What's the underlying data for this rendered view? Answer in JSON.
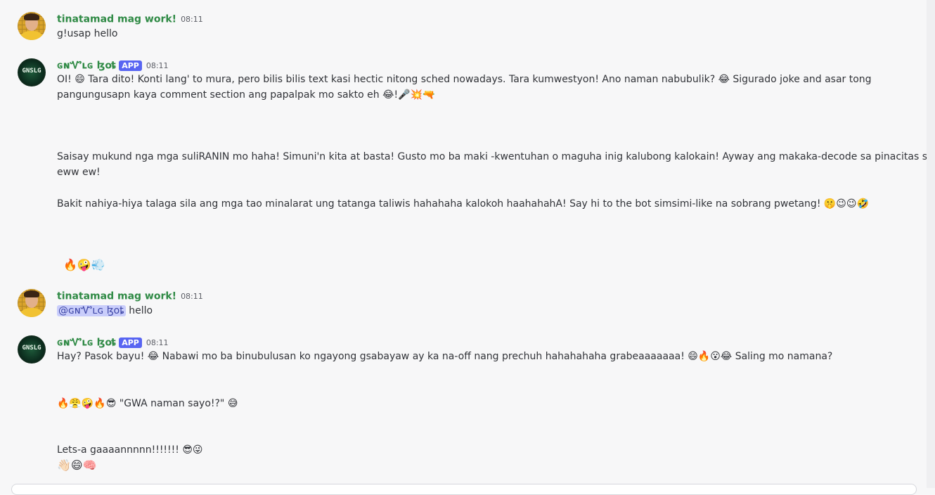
{
  "messages": [
    {
      "author": "tinatamad mag work!",
      "time": "08:11",
      "lines": [
        "g!usap hello"
      ]
    },
    {
      "author": "ɢɴᏉʟɢ ɮօȶ",
      "badge": "APP",
      "time": "08:11",
      "lines": [
        "OI! 😄 Tara dito! Konti lang' to mura, pero bilis bilis text kasi hectic  nitong sched nowadays. Tara kumwestyon! Ano naman nabubulik? 😂  Sigurado joke and asar tong",
        "pangungusapn kaya comment section ang papalpak mo sakto eh 😂!🎤💥🔫",
        "Saisay mukund nga mga suliRANIN mo haha! Simuni'n kita at basta! Gusto mo ba maki -kwentuhan o maguha inig kalubong kalokain! Ayway ang makaka-decode sa pinacitas siyan",
        "eww ew!",
        "Bakit nahiya-hiya talaga sila ang mga tao minalarat ung tatanga taliwis hahahaha kalokoh haahahahA! Say hi to the bot simsimi-like na sobrang pwetang! 🤫😉😉🤣",
        "🔥🤪💨"
      ]
    },
    {
      "author": "tinatamad mag work!",
      "time": "08:11",
      "mention": "@ɢɴᏉʟɢ ɮօȶ",
      "text_after_mention": " hello"
    },
    {
      "author": "ɢɴᏉʟɢ ɮօȶ",
      "badge": "APP",
      "time": "08:11",
      "lines": [
        "Hay? Pasok bayu! 😂  Nabawi mo ba binubulusan ko ngayong gsabayaw ay ka na-off nang prechuh  hahahahaha grabeaaaaaaa! 😄🔥😮😂  Saling mo namana?",
        "🔥😤🤪🔥😎 \"GWA naman sayo!?\" 😅",
        "Lets-a gaaaannnnn!!!!!!! 😎😜",
        "👋🏻😄🧠"
      ]
    }
  ],
  "avatars": {
    "bot_text": "GNSLG"
  },
  "colors": {
    "username": "#2f8a45",
    "app_badge": "#5865f2",
    "mention_bg": "#c9cdfb",
    "background": "#f7f7f8"
  }
}
